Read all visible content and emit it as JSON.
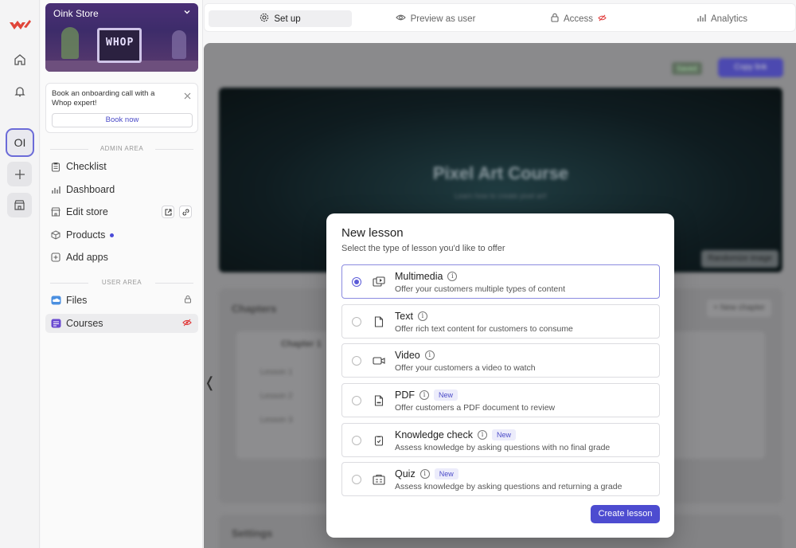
{
  "app": {
    "brand_color": "#E0463A",
    "accent": "#4D4CD0"
  },
  "rail": {
    "avatar_initials": "OI"
  },
  "sidebar": {
    "store_name": "Oink Store",
    "store_art_text": "WHOP",
    "promo": {
      "text": "Book an onboarding call with a Whop expert!",
      "button": "Book now"
    },
    "admin_section": "ADMIN AREA",
    "user_section": "USER AREA",
    "items": [
      {
        "label": "Checklist",
        "icon": "clipboard-icon"
      },
      {
        "label": "Dashboard",
        "icon": "bar-chart-icon"
      },
      {
        "label": "Edit store",
        "icon": "store-icon"
      },
      {
        "label": "Products",
        "icon": "cube-icon"
      },
      {
        "label": "Add apps",
        "icon": "plus-square-icon"
      },
      {
        "label": "Files",
        "icon": "cloud-icon"
      },
      {
        "label": "Courses",
        "icon": "courses-icon"
      }
    ]
  },
  "tabs": [
    {
      "label": "Set up",
      "icon": "gear-icon",
      "active": true
    },
    {
      "label": "Preview as user",
      "icon": "eye-icon"
    },
    {
      "label": "Access",
      "icon": "lock-icon"
    },
    {
      "label": "Analytics",
      "icon": "bar-chart-icon"
    }
  ],
  "background": {
    "saved": "Saved",
    "copy_link": "Copy link",
    "banner_title": "Pixel Art Course",
    "banner_subtitle": "Learn how to create pixel art!",
    "randomize": "Randomize image",
    "chapters_heading": "Chapters",
    "new_chapter": "+ New chapter",
    "chapter_name": "Chapter 1",
    "lessons": [
      "Lesson 1",
      "Lesson 2",
      "Lesson 3"
    ],
    "settings_heading": "Settings"
  },
  "modal": {
    "title": "New lesson",
    "subtitle": "Select the type of lesson you'd like to offer",
    "options": [
      {
        "name": "Multimedia",
        "desc": "Offer your customers multiple types of content",
        "badge": "",
        "selected": true
      },
      {
        "name": "Text",
        "desc": "Offer rich text content for customers to consume",
        "badge": ""
      },
      {
        "name": "Video",
        "desc": "Offer your customers a video to watch",
        "badge": ""
      },
      {
        "name": "PDF",
        "desc": "Offer customers a PDF document to review",
        "badge": "New"
      },
      {
        "name": "Knowledge check",
        "desc": "Assess knowledge by asking questions with no final grade",
        "badge": "New"
      },
      {
        "name": "Quiz",
        "desc": "Assess knowledge by asking questions and returning a grade",
        "badge": "New"
      }
    ],
    "create_button": "Create lesson"
  }
}
